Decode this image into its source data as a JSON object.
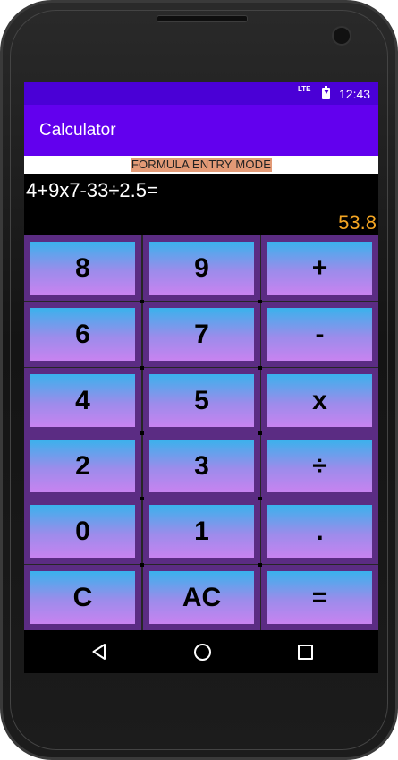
{
  "status_bar": {
    "network": "LTE",
    "time": "12:43",
    "battery_icon": "battery-charging-icon"
  },
  "app_bar": {
    "title": "Calculator"
  },
  "mode": {
    "label": "FORMULA ENTRY MODE"
  },
  "display": {
    "formula": "4+9x7-33÷2.5=",
    "result": "53.8"
  },
  "keys": [
    {
      "label": "8",
      "name": "key-8"
    },
    {
      "label": "9",
      "name": "key-9"
    },
    {
      "label": "+",
      "name": "key-plus"
    },
    {
      "label": "6",
      "name": "key-6"
    },
    {
      "label": "7",
      "name": "key-7"
    },
    {
      "label": "-",
      "name": "key-minus"
    },
    {
      "label": "4",
      "name": "key-4"
    },
    {
      "label": "5",
      "name": "key-5"
    },
    {
      "label": "x",
      "name": "key-multiply"
    },
    {
      "label": "2",
      "name": "key-2"
    },
    {
      "label": "3",
      "name": "key-3"
    },
    {
      "label": "÷",
      "name": "key-divide"
    },
    {
      "label": "0",
      "name": "key-0"
    },
    {
      "label": "1",
      "name": "key-1"
    },
    {
      "label": ".",
      "name": "key-decimal"
    },
    {
      "label": "C",
      "name": "key-clear"
    },
    {
      "label": "AC",
      "name": "key-all-clear"
    },
    {
      "label": "=",
      "name": "key-equals"
    }
  ],
  "nav_bar": {
    "back_icon": "back-triangle-icon",
    "home_icon": "home-circle-icon",
    "recent_icon": "recent-apps-square-icon"
  },
  "colors": {
    "status_bar": "#4a00d6",
    "app_bar": "#6200ee",
    "mode_label_bg": "#e39a76",
    "result_text": "#f5a623",
    "key_frame": "#5b2c83",
    "key_gradient_top": "#3ab2ec",
    "key_gradient_bottom": "#c883f0"
  }
}
